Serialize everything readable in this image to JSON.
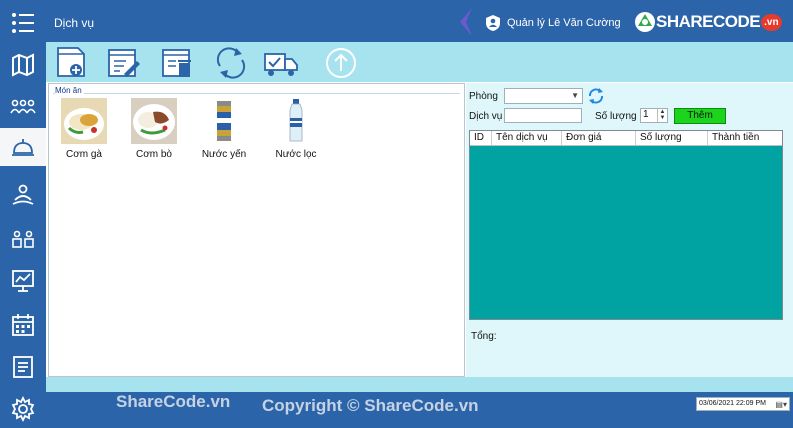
{
  "colors": {
    "primary": "#2b64a8",
    "toolbar_bg": "#a7e3ef",
    "grid_bg": "#00a2a2",
    "add_button": "#1cd41c",
    "logo_badge": "#e53b2c"
  },
  "sidebar": {
    "items": [
      {
        "name": "menu-icon"
      },
      {
        "name": "map-icon"
      },
      {
        "name": "customers-icon"
      },
      {
        "name": "service-bell-icon",
        "active": true
      },
      {
        "name": "staff-icon"
      },
      {
        "name": "rooms-icon"
      },
      {
        "name": "statistics-icon"
      },
      {
        "name": "calendar-icon"
      },
      {
        "name": "report-icon"
      },
      {
        "name": "settings-icon"
      }
    ]
  },
  "header": {
    "title": "Dịch vụ",
    "user_label": "Quản lý Lê Văn Cường",
    "logo_text": "SHARECODE",
    "logo_suffix": ".vn"
  },
  "toolbar": {
    "buttons": [
      "add-document-icon",
      "edit-document-icon",
      "delete-document-icon",
      "refresh-icon",
      "delivery-check-icon",
      "upload-icon"
    ]
  },
  "menu": {
    "group_label": "Món ăn",
    "items": [
      {
        "name": "Cơm gà"
      },
      {
        "name": "Cơm bò"
      },
      {
        "name": "Nước yến"
      },
      {
        "name": "Nước lọc"
      }
    ]
  },
  "order": {
    "room_label": "Phòng",
    "room_value": "",
    "service_label": "Dịch vụ",
    "service_value": "",
    "quantity_label": "Số lượng",
    "quantity_value": "1",
    "add_label": "Thêm",
    "columns": [
      "ID",
      "Tên dịch vụ",
      "Đơn giá",
      "Số lượng",
      "Thành tiền"
    ],
    "total_label": "Tổng:"
  },
  "status": {
    "watermark": "ShareCode.vn",
    "copyright": "Copyright © ShareCode.vn",
    "datetime": "03/06/2021 22:09 PM"
  }
}
